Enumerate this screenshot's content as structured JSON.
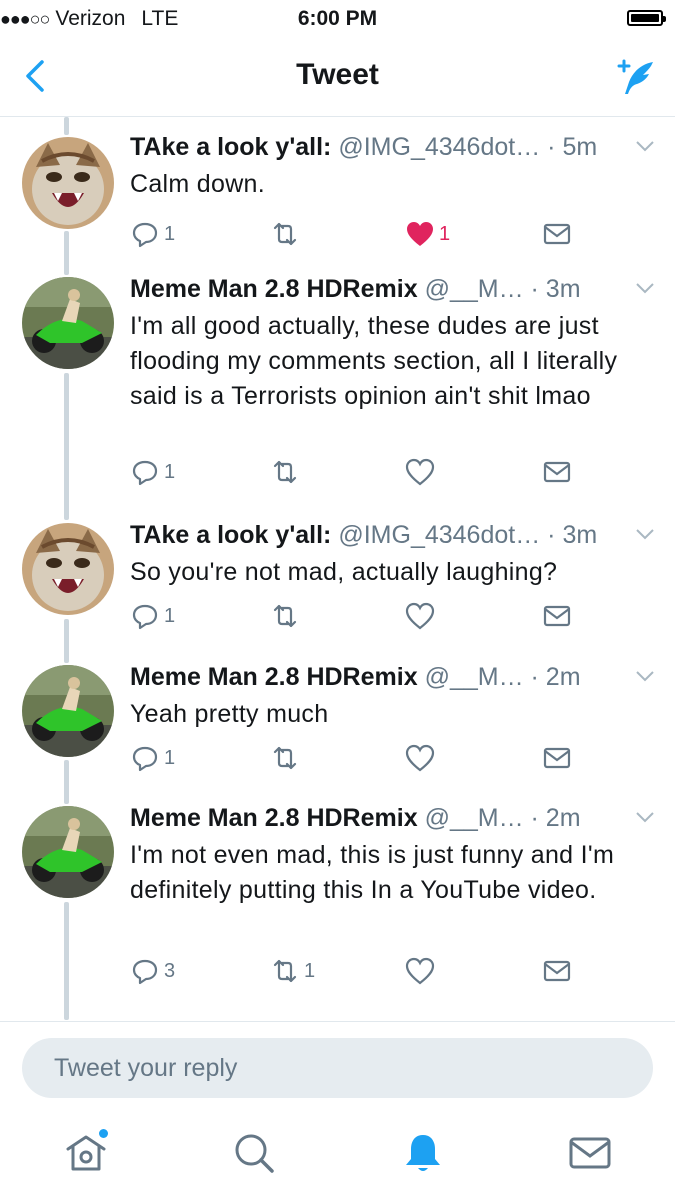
{
  "status_bar": {
    "signal": "●●●○○",
    "carrier": "Verizon",
    "network": "LTE",
    "time": "6:00 PM"
  },
  "nav": {
    "title": "Tweet",
    "back_icon": "chevron-left-icon",
    "compose_icon": "compose-tweet-icon"
  },
  "colors": {
    "accent": "#1da1f2",
    "like": "#e0245e",
    "muted": "#657786",
    "thread_line": "#ccd6dd"
  },
  "tweets": [
    {
      "name": "TAke a look y'all:",
      "handle": "@IMG_4346dot…",
      "time": "· 5m",
      "avatar": "cat-avatar",
      "text": "Calm down.",
      "replies": "1",
      "retweets": "",
      "likes": "1",
      "liked": true
    },
    {
      "name": "Meme Man 2.8 HDRemix",
      "handle": "@__M…",
      "time": "· 3m",
      "avatar": "motorcycle-avatar",
      "text": "I'm all good actually, these dudes are just flooding my comments section, all I literally said is a Terrorists opinion ain't shit lmao",
      "replies": "1",
      "retweets": "",
      "likes": "",
      "liked": false
    },
    {
      "name": "TAke a look y'all:",
      "handle": "@IMG_4346dot…",
      "time": "· 3m",
      "avatar": "cat-avatar",
      "text": "So you're not mad, actually laughing?",
      "replies": "1",
      "retweets": "",
      "likes": "",
      "liked": false
    },
    {
      "name": "Meme Man 2.8 HDRemix",
      "handle": "@__M…",
      "time": "· 2m",
      "avatar": "motorcycle-avatar",
      "text": "Yeah pretty much",
      "replies": "1",
      "retweets": "",
      "likes": "",
      "liked": false
    },
    {
      "name": "Meme Man 2.8 HDRemix",
      "handle": "@__M…",
      "time": "· 2m",
      "avatar": "motorcycle-avatar",
      "text": "I'm not even mad, this is just funny and I'm definitely putting this In a YouTube video.",
      "replies": "3",
      "retweets": "1",
      "likes": "",
      "liked": false
    }
  ],
  "reply": {
    "placeholder": "Tweet your reply"
  },
  "tabbar": {
    "items": [
      {
        "icon": "home-icon",
        "active": false,
        "badge": true
      },
      {
        "icon": "search-icon",
        "active": false,
        "badge": false
      },
      {
        "icon": "notifications-bell-icon",
        "active": true,
        "badge": false
      },
      {
        "icon": "messages-envelope-icon",
        "active": false,
        "badge": false
      }
    ]
  }
}
